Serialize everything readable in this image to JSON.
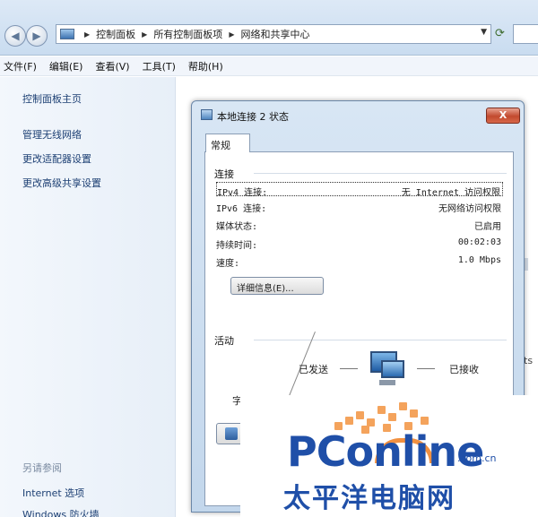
{
  "addressbar": {
    "breadcrumb": [
      "控制面板",
      "所有控制面板项",
      "网络和共享中心"
    ]
  },
  "menubar": {
    "items": [
      "文件(F)",
      "编辑(E)",
      "查看(V)",
      "工具(T)",
      "帮助(H)"
    ]
  },
  "sidebar": {
    "home": "控制面板主页",
    "links": [
      "管理无线网络",
      "更改适配器设置",
      "更改高级共享设置"
    ],
    "see_also": "另请参阅",
    "see_also_links": [
      "Internet 选项",
      "Windows 防火墙"
    ]
  },
  "dialog": {
    "title": "本地连接 2 状态",
    "close_label": "X",
    "tab": "常规",
    "connection_group": "连接",
    "rows": [
      {
        "key": "IPv4 连接:",
        "value": "无 Internet 访问权限"
      },
      {
        "key": "IPv6 连接:",
        "value": "无网络访问权限"
      },
      {
        "key": "媒体状态:",
        "value": "已启用"
      },
      {
        "key": "持续时间:",
        "value": "00:02:03"
      },
      {
        "key": "速度:",
        "value": "1.0 Mbps"
      }
    ],
    "details_button": "详细信息(E)...",
    "activity_group": "活动",
    "sent_label": "已发送",
    "received_label": "已接收",
    "bytes_label": "字"
  },
  "rightfrag": "ts",
  "watermark": {
    "brand": "PConline",
    "domain": ".com.cn",
    "cn": "太平洋电脑网"
  }
}
